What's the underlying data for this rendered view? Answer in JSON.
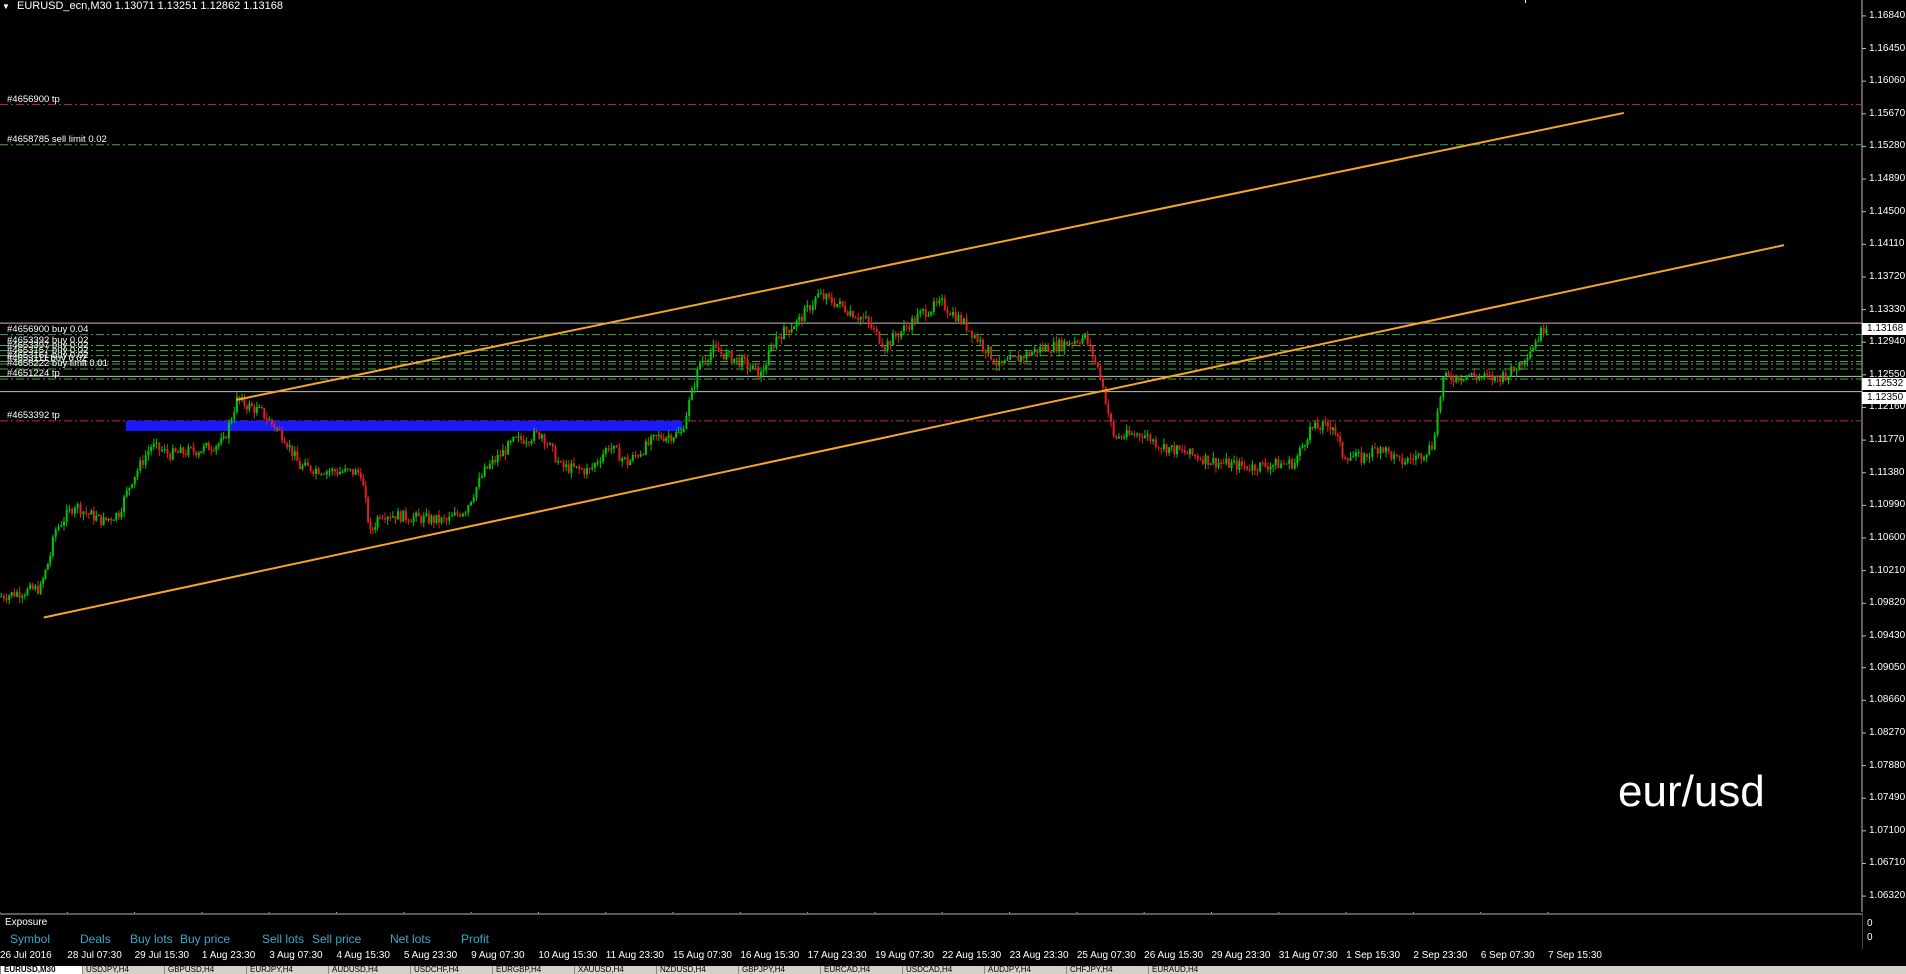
{
  "header": {
    "symbol_line": "EURUSD_ecn,M30  1.13071 1.13251 1.12862 1.13168"
  },
  "colors": {
    "background": "#000000",
    "bull_candle": "#00c800",
    "bear_candle": "#e02020",
    "channel_lines": "#f5a623",
    "support_zone": "#1a1aff",
    "tp_line": "#c03030",
    "order_line": "#3fae3f",
    "exposure_header": "#39a8c9"
  },
  "orders": [
    {
      "label": "#4656900 tp",
      "price": 1.1578,
      "kind": "tp"
    },
    {
      "label": "#4658785 sell limit 0.02",
      "price": 1.153,
      "kind": "order"
    },
    {
      "label": "#4656900 buy 0.04",
      "price": 1.1303,
      "kind": "order"
    },
    {
      "label": "#4653392 buy 0.02",
      "price": 1.129,
      "kind": "order"
    },
    {
      "label": "#4653397 buy 0.02",
      "price": 1.1284,
      "kind": "order"
    },
    {
      "label": "#4653157 buy 0.02",
      "price": 1.1278,
      "kind": "order"
    },
    {
      "label": "#4653151 buy 0.02",
      "price": 1.1271,
      "kind": "order"
    },
    {
      "label": "#4653111 buy 0.02",
      "price": 1.1268,
      "kind": "order"
    },
    {
      "label": "#4658222 buy limit 0.01",
      "price": 1.1262,
      "kind": "order"
    },
    {
      "label": "#4651224 tp",
      "price": 1.125,
      "kind": "order"
    },
    {
      "label": "#4653392 tp",
      "price": 1.12,
      "kind": "tp"
    }
  ],
  "price_marks": {
    "current": "1.13168",
    "mark_2": "1.12532",
    "mark_3": "1.12350"
  },
  "watermark": "eur/usd",
  "chart_data": {
    "type": "candlestick",
    "symbol": "EURUSD_ecn",
    "timeframe": "M30",
    "ohlc": {
      "open": 1.13071,
      "high": 1.13251,
      "low": 1.12862,
      "close": 1.13168
    },
    "ylim": [
      1.0613,
      1.1703
    ],
    "y_ticks": [
      "1.16840",
      "1.16450",
      "1.16060",
      "1.15670",
      "1.15280",
      "1.14890",
      "1.14500",
      "1.14110",
      "1.13720",
      "1.13330",
      "1.12940",
      "1.12550",
      "1.12160",
      "1.11770",
      "1.11380",
      "1.10990",
      "1.10600",
      "1.10210",
      "1.09820",
      "1.09430",
      "1.09050",
      "1.08660",
      "1.08270",
      "1.07880",
      "1.07490",
      "1.07100",
      "1.06710",
      "1.06320"
    ],
    "x_ticks": [
      "26 Jul 2016",
      "28 Jul 07:30",
      "29 Jul 15:30",
      "1 Aug 23:30",
      "3 Aug 07:30",
      "4 Aug 15:30",
      "5 Aug 23:30",
      "9 Aug 07:30",
      "10 Aug 15:30",
      "11 Aug 23:30",
      "15 Aug 07:30",
      "16 Aug 15:30",
      "17 Aug 23:30",
      "19 Aug 07:30",
      "22 Aug 15:30",
      "23 Aug 23:30",
      "25 Aug 07:30",
      "26 Aug 15:30",
      "29 Aug 23:30",
      "31 Aug 07:30",
      "1 Sep 15:30",
      "2 Sep 23:30",
      "6 Sep 07:30",
      "7 Sep 15:30"
    ],
    "price_path": [
      [
        0,
        1.099
      ],
      [
        0.022,
        1.1
      ],
      [
        0.027,
        1.104
      ],
      [
        0.03,
        1.107
      ],
      [
        0.04,
        1.11
      ],
      [
        0.046,
        1.109
      ],
      [
        0.055,
        1.108
      ],
      [
        0.063,
        1.109
      ],
      [
        0.07,
        1.113
      ],
      [
        0.08,
        1.117
      ],
      [
        0.09,
        1.116
      ],
      [
        0.105,
        1.1165
      ],
      [
        0.118,
        1.1175
      ],
      [
        0.125,
        1.1225
      ],
      [
        0.138,
        1.121
      ],
      [
        0.15,
        1.118
      ],
      [
        0.158,
        1.1145
      ],
      [
        0.175,
        1.114
      ],
      [
        0.19,
        1.1138
      ],
      [
        0.195,
        1.1065
      ],
      [
        0.2,
        1.109
      ],
      [
        0.215,
        1.1085
      ],
      [
        0.235,
        1.108
      ],
      [
        0.245,
        1.1095
      ],
      [
        0.255,
        1.114
      ],
      [
        0.27,
        1.1175
      ],
      [
        0.285,
        1.1185
      ],
      [
        0.295,
        1.1145
      ],
      [
        0.31,
        1.114
      ],
      [
        0.32,
        1.117
      ],
      [
        0.33,
        1.115
      ],
      [
        0.345,
        1.118
      ],
      [
        0.358,
        1.1185
      ],
      [
        0.368,
        1.127
      ],
      [
        0.375,
        1.1285
      ],
      [
        0.39,
        1.127
      ],
      [
        0.4,
        1.1255
      ],
      [
        0.408,
        1.13
      ],
      [
        0.42,
        1.132
      ],
      [
        0.43,
        1.135
      ],
      [
        0.44,
        1.134
      ],
      [
        0.455,
        1.132
      ],
      [
        0.465,
        1.129
      ],
      [
        0.475,
        1.131
      ],
      [
        0.485,
        1.133
      ],
      [
        0.495,
        1.134
      ],
      [
        0.505,
        1.132
      ],
      [
        0.515,
        1.1295
      ],
      [
        0.525,
        1.1265
      ],
      [
        0.535,
        1.1275
      ],
      [
        0.545,
        1.1285
      ],
      [
        0.555,
        1.129
      ],
      [
        0.57,
        1.13
      ],
      [
        0.578,
        1.1255
      ],
      [
        0.585,
        1.118
      ],
      [
        0.6,
        1.1185
      ],
      [
        0.61,
        1.117
      ],
      [
        0.625,
        1.116
      ],
      [
        0.64,
        1.115
      ],
      [
        0.655,
        1.1145
      ],
      [
        0.67,
        1.1148
      ],
      [
        0.68,
        1.115
      ],
      [
        0.688,
        1.119
      ],
      [
        0.7,
        1.1195
      ],
      [
        0.705,
        1.116
      ],
      [
        0.715,
        1.1155
      ],
      [
        0.725,
        1.117
      ],
      [
        0.735,
        1.115
      ],
      [
        0.745,
        1.1158
      ],
      [
        0.752,
        1.117
      ],
      [
        0.758,
        1.125
      ],
      [
        0.77,
        1.1255
      ],
      [
        0.785,
        1.125
      ],
      [
        0.795,
        1.126
      ],
      [
        0.805,
        1.129
      ],
      [
        0.812,
        1.1316
      ]
    ],
    "channel_upper": [
      [
        1.0985,
        1.1225
      ],
      [
        1.8,
        1.1568
      ]
    ],
    "channel_lower": [
      [
        1.0985,
        1.0965
      ],
      [
        1.8,
        1.141
      ]
    ],
    "support_zone": {
      "from": 1.1188,
      "to": 1.12
    },
    "grid": false
  },
  "exposure": {
    "title": "Exposure",
    "columns": [
      "Symbol",
      "Deals",
      "Buy lots",
      "Buy price",
      "Sell lots",
      "Sell price",
      "Net lots",
      "Profit"
    ],
    "zero_top": "0",
    "zero_bottom": "0"
  },
  "tabs": [
    "EURUSD,M30",
    "USDJPY,H4",
    "GBPUSD,H4",
    "EURJPY,H4",
    "AUDUSD,H4",
    "USDCHF,H4",
    "EURGBP,H4",
    "XAUUSD,H4",
    "NZDUSD,H4",
    "GBPJPY,H4",
    "EURCAD,H4",
    "USDCAD,H4",
    "AUDJPY,H4",
    "CHFJPY,H4",
    "EURAUD,H4"
  ]
}
